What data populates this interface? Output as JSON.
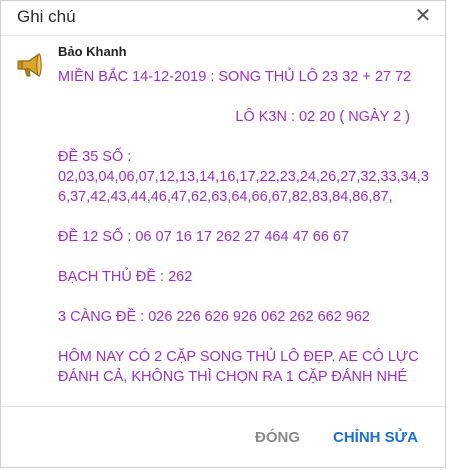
{
  "dialog": {
    "title": "Ghi chú",
    "close_glyph": "✕"
  },
  "note": {
    "icon": "megaphone-icon",
    "author": "Bảo Khanh",
    "lines": {
      "l1": "MIỀN BẮC 14-12-2019 : SONG THỦ LÔ 23 32 + 27 72",
      "l2": "LÔ K3N : 02 20 ( NGÀY 2  )",
      "l3": "ĐỀ 35 SỐ :",
      "l4": "02,03,04,06,07,12,13,14,16,17,22,23,24,26,27,32,33,34,36,37,42,43,44,46,47,62,63,64,66,67,82,83,84,86,87,",
      "l5": "ĐỀ 12 SỐ : 06 07 16 17 262 27 464 47 66 67",
      "l6": "BẠCH THỦ ĐỀ : 262",
      "l7": "3 CÀNG ĐỀ : 026 226 626 926 062 262 662 962",
      "l8": "HÔM NAY CÓ 2 CẶP SONG THỦ LÔ ĐẸP. AE CÓ LỰC ĐÁNH CẢ, KHÔNG THÌ CHỌN RA 1 CẶP ĐÁNH NHÉ"
    }
  },
  "footer": {
    "close_label": "ĐÓNG",
    "edit_label": "CHỈNH SỬA"
  },
  "colors": {
    "note_text": "#9b2fc7",
    "primary_button": "#1a6fd1",
    "secondary_button": "#8a8a8a"
  }
}
